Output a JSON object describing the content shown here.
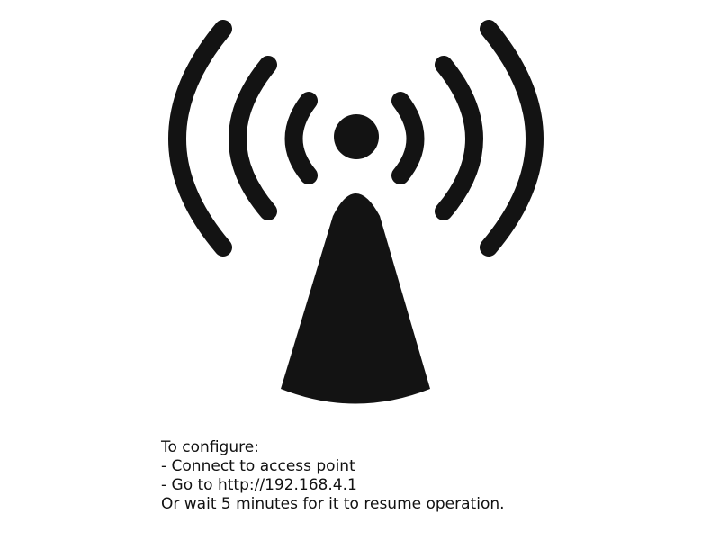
{
  "icon": {
    "name": "wifi-access-point-icon",
    "color": "#131313"
  },
  "instructions": {
    "heading": "To configure:",
    "step_connect": "- Connect to access point",
    "step_goto": "- Go to http://192.168.4.1",
    "footer": "Or wait 5 minutes for it to resume operation."
  },
  "colors": {
    "background": "#ffffff",
    "text": "#111111"
  }
}
